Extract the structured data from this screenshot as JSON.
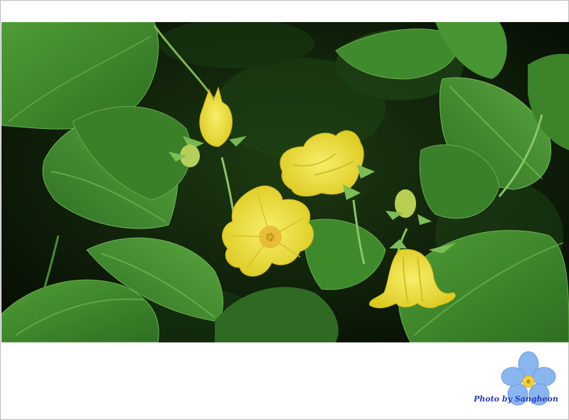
{
  "photo": {
    "subject": "yellow-flowers-green-leaves",
    "colors": {
      "flower": "#f2e43a",
      "flower_shade": "#d8c61f",
      "leaf": "#3f8a2c",
      "leaf_light": "#5aa63f",
      "background": "#0b1a08"
    }
  },
  "watermark": {
    "credit_text": "Photo by Sangheon",
    "icon": "blue-flower-icon",
    "colors": {
      "petal": "#8ab6f0",
      "center": "#f3d33a",
      "text": "#2a39c8"
    }
  }
}
